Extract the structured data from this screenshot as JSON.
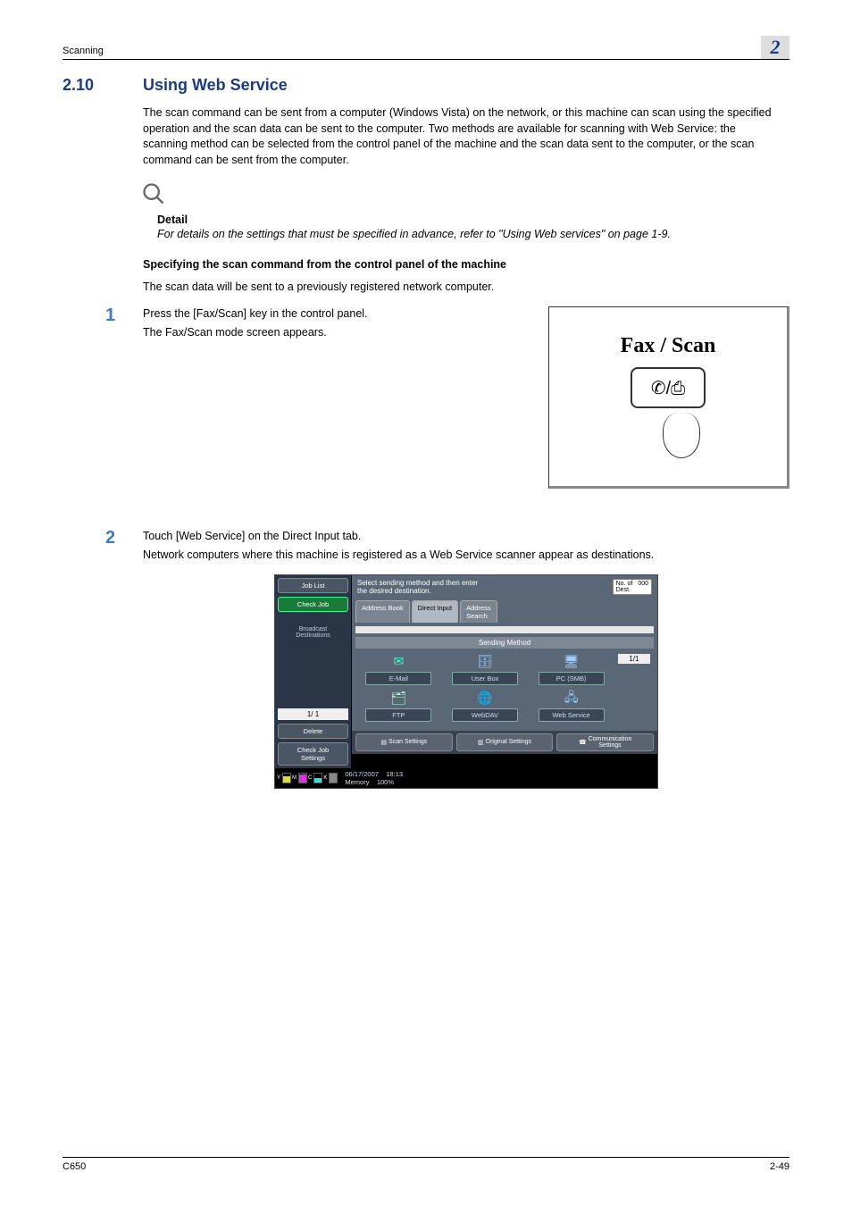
{
  "header": {
    "left": "Scanning",
    "chapter": "2"
  },
  "section": {
    "number": "2.10",
    "title": "Using Web Service"
  },
  "intro": "The scan command can be sent from a computer (Windows Vista) on the network, or this machine can scan using the specified operation and the scan data can be sent to the computer. Two methods are available for scanning with Web Service: the scanning method can be selected from the control panel of the machine and the scan data sent to the computer, or the scan command can be sent from the computer.",
  "detail": {
    "label": "Detail",
    "text": "For details on the settings that must be specified in advance, refer to \"Using Web services\" on page 1-9."
  },
  "subhead": "Specifying the scan command from the control panel of the machine",
  "sub_intro": "The scan data will be sent to a previously registered network computer.",
  "step1": {
    "num": "1",
    "line1": "Press the [Fax/Scan] key in the control panel.",
    "line2": "The Fax/Scan mode screen appears.",
    "graphic_label": "Fax / Scan"
  },
  "step2": {
    "num": "2",
    "line1": "Touch [Web Service] on the Direct Input tab.",
    "line2": "Network computers where this machine is registered as a Web Service scanner appear as destinations."
  },
  "panel": {
    "side": {
      "job_list": "Job List",
      "check_job": "Check Job",
      "broadcast": "Broadcast\nDestinations",
      "counter": "1/   1",
      "delete": "Delete",
      "check_settings": "Check Job\nSettings"
    },
    "top_prompt": "Select sending method and then enter\nthe desired destination.",
    "dest_label": "No. of\nDest.",
    "dest_count": "000",
    "tabs": {
      "address_book": "Address Book",
      "direct_input": "Direct Input",
      "address_search": "Address\nSearch"
    },
    "sending_method_label": "Sending Method",
    "methods": {
      "email": "E-Mail",
      "userbox": "User Box",
      "pcsmb": "PC (SMB)",
      "ftp": "FTP",
      "webdav": "WebDAV",
      "webservice": "Web Service"
    },
    "page_indicator": "1/1",
    "bottom": {
      "scan_settings": "Scan Settings",
      "original_settings": "Original Settings",
      "comm_settings": "Communication\nSettings"
    },
    "status": {
      "date": "06/17/2007",
      "time": "18:13",
      "memory_label": "Memory",
      "memory_value": "100%"
    },
    "toner": {
      "y": "Y",
      "m": "M",
      "c": "C",
      "k": "K"
    }
  },
  "footer": {
    "left": "C650",
    "right": "2-49"
  }
}
